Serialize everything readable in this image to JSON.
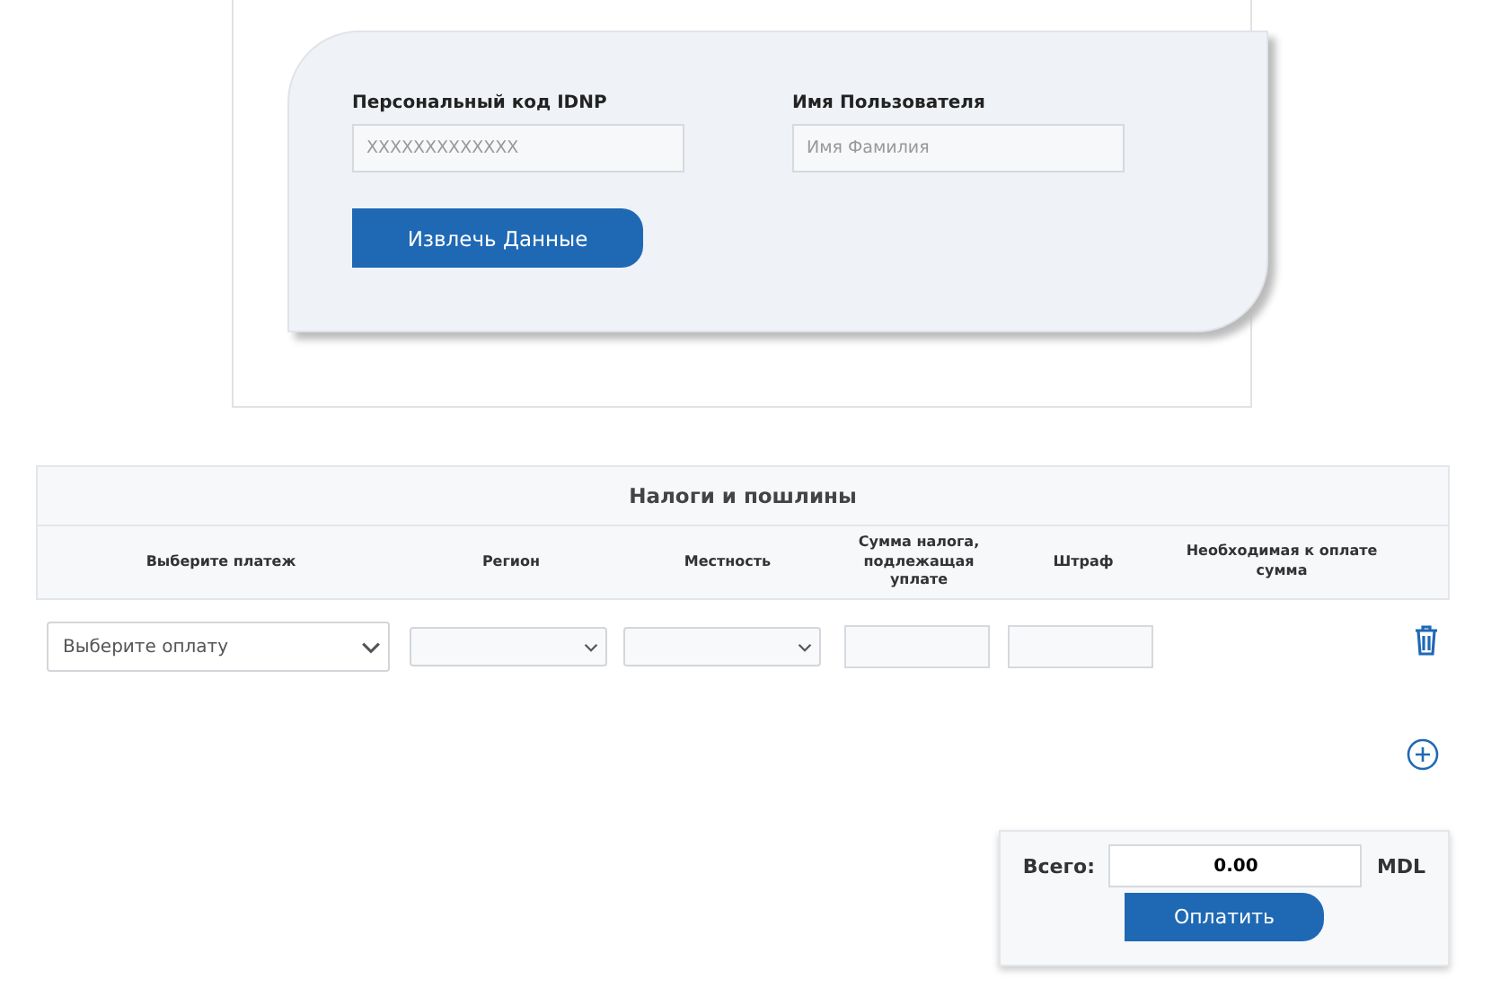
{
  "identify_form": {
    "fields": [
      {
        "label": "Персональный код IDNP",
        "placeholder": "XXXXXXXXXXXXX"
      },
      {
        "label": "Имя Пользователя",
        "placeholder": "Имя Фамилия"
      }
    ],
    "button": "Извлечь Данные"
  },
  "taxes_table": {
    "title": "Налоги и пошлины",
    "columns": [
      "Выберите платеж",
      "Регион",
      "Местность",
      "Сумма налога, подлежащая уплате",
      "Штраф",
      "Необходимая к оплате сумма"
    ],
    "rows": [
      {
        "payment": "Выберите оплату"
      }
    ]
  },
  "total": {
    "label": "Всего:",
    "value": "0.00",
    "currency": "MDL",
    "button": "Оплатить"
  }
}
